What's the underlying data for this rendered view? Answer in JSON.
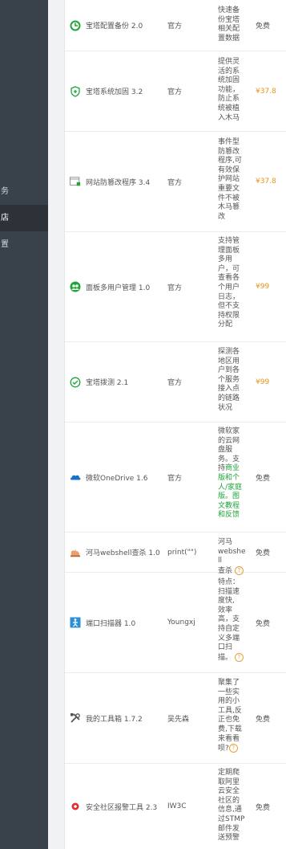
{
  "sidebar": {
    "items": [
      {
        "label": "务",
        "active": false
      },
      {
        "label": "店",
        "active": true
      },
      {
        "label": "置",
        "active": false
      }
    ]
  },
  "plugins": [
    {
      "name": "宝塔配置备份 2.0",
      "icon": "backup-clock-icon",
      "developer": "官方",
      "desc_lines": [
        "快速备",
        "份宝塔",
        "相关配",
        "置数据"
      ],
      "price": "免费"
    },
    {
      "name": "宝塔系统加固 3.2",
      "icon": "shield-plus-icon",
      "developer": "官方",
      "desc_lines": [
        "提供灵",
        "活的系",
        "统加固",
        "功能，",
        "防止系",
        "统被植",
        "入木马"
      ],
      "price": "¥37.8"
    },
    {
      "name": "网站防篡改程序 3.4",
      "icon": "web-lock-icon",
      "developer": "官方",
      "desc_lines": [
        "事件型",
        "防篡改",
        "程序,可",
        "有效保",
        "护网站",
        "重要文",
        "件不被",
        "木马篡",
        "改"
      ],
      "price": "¥37.8"
    },
    {
      "name": "面板多用户管理 1.0",
      "icon": "multi-user-icon",
      "developer": "官方",
      "desc_lines": [
        "支持管",
        "理面板",
        "多用",
        "户，可",
        "查看各",
        "个用户",
        "日志，",
        "但不支",
        "持权限",
        "分配"
      ],
      "price": "¥99"
    },
    {
      "name": "宝塔拨测 2.1",
      "icon": "probe-check-icon",
      "developer": "官方",
      "desc_lines": [
        "探测各",
        "地区用",
        "户到各",
        "个服务",
        "接入点",
        "的链路",
        "状况"
      ],
      "price": "¥99"
    },
    {
      "name": "微软OneDrive 1.6",
      "icon": "onedrive-cloud-icon",
      "developer": "官方",
      "desc_lines": [
        "微软家",
        "的云网",
        "盘服",
        "务。支"
      ],
      "desc_mixed": [
        {
          "pre": "持",
          "link": "商业"
        }
      ],
      "desc_green": [
        "版和个",
        "人/家庭",
        "版。图",
        "文教程",
        "和反馈"
      ],
      "price": "免费"
    },
    {
      "name": "河马webshell查杀 1.0",
      "icon": "hippo-scan-icon",
      "developer": "print(\"\")",
      "desc_lines": [
        "河马",
        "webshell",
        "查杀"
      ],
      "help": "?",
      "price": "免费"
    },
    {
      "name": "端口扫描器 1.0",
      "icon": "port-scan-icon",
      "developer": "Youngxj",
      "desc_lines": [
        "特点：",
        "扫描速",
        "度快,",
        "效率",
        "高，支",
        "持自定",
        "义多端",
        "口扫",
        "描。"
      ],
      "help": "?",
      "price": "免费"
    },
    {
      "name": "我的工具箱 1.7.2",
      "icon": "toolbox-icon",
      "developer": "吴先森",
      "desc_lines": [
        "聚集了",
        "一些实",
        "用的小",
        "工具,反",
        "正也免",
        "费,下载",
        "来看看",
        "呗?"
      ],
      "help": "?",
      "price": "免费"
    },
    {
      "name": "安全社区报警工具 2.3",
      "icon": "alarm-icon",
      "developer": "IW3C",
      "desc_lines": [
        "定期爬",
        "取阿里",
        "云安全",
        "社区的",
        "信息,通",
        "过STMP",
        "邮件发",
        "送预警"
      ],
      "price": "免费"
    }
  ]
}
